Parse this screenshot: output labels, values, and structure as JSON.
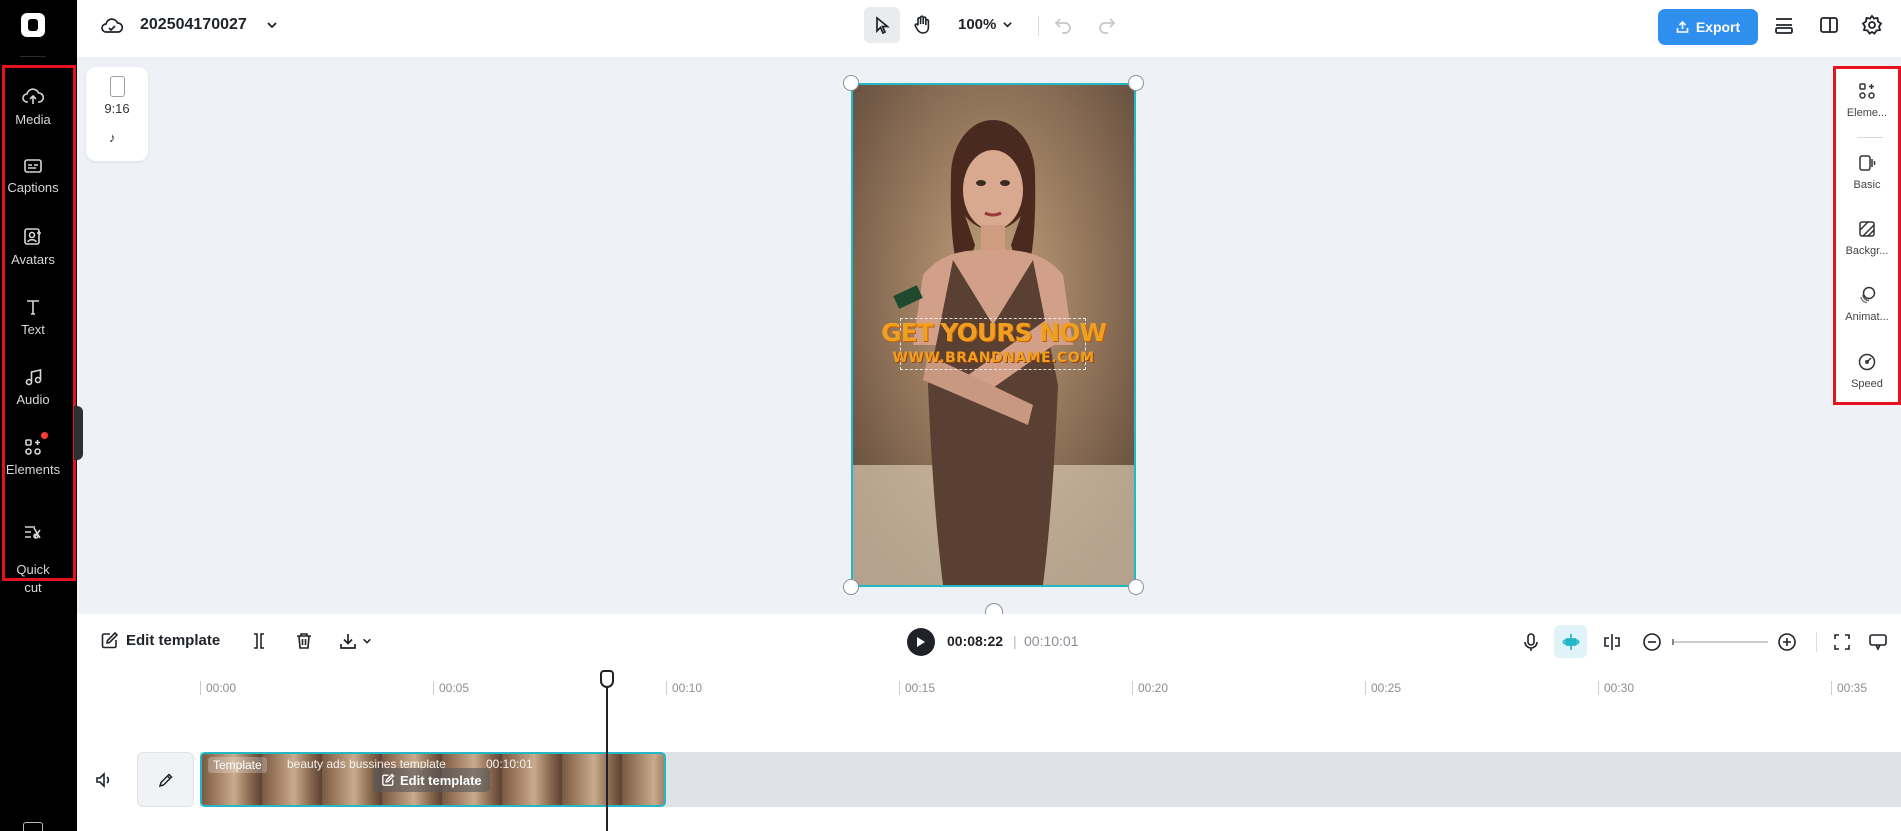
{
  "left_nav": {
    "items": [
      {
        "id": "media",
        "label": "Media",
        "icon": "cloud-upload-icon"
      },
      {
        "id": "captions",
        "label": "Captions",
        "icon": "captions-icon"
      },
      {
        "id": "avatars",
        "label": "Avatars",
        "icon": "avatar-icon"
      },
      {
        "id": "text",
        "label": "Text",
        "icon": "text-icon"
      },
      {
        "id": "audio",
        "label": "Audio",
        "icon": "music-note-icon"
      },
      {
        "id": "elements",
        "label": "Elements",
        "icon": "elements-icon"
      },
      {
        "id": "quickcut",
        "label": "Quick\ncut",
        "icon": "quick-cut-icon"
      }
    ]
  },
  "topbar": {
    "project_name": "202504170027",
    "zoom": "100%",
    "export_label": "Export"
  },
  "aspect": {
    "ratio": "9:16"
  },
  "canvas": {
    "headline": "GET YOURS NOW",
    "url": "WWW.BRANDNAME.COM"
  },
  "right_panel": {
    "items": [
      {
        "id": "elements",
        "label": "Eleme...",
        "icon": "elements-icon"
      },
      {
        "id": "basic",
        "label": "Basic",
        "icon": "basic-icon"
      },
      {
        "id": "background",
        "label": "Backgr...",
        "icon": "background-icon"
      },
      {
        "id": "animation",
        "label": "Animat...",
        "icon": "animation-icon"
      },
      {
        "id": "speed",
        "label": "Speed",
        "icon": "speed-icon"
      }
    ]
  },
  "timeline_toolbar": {
    "edit_template_label": "Edit template",
    "current_time": "00:08:22",
    "separator": "|",
    "total_time": "00:10:01"
  },
  "ruler": {
    "ticks": [
      "00:00",
      "00:05",
      "00:10",
      "00:15",
      "00:20",
      "00:25",
      "00:30",
      "00:35"
    ]
  },
  "clip": {
    "tag": "Template",
    "name": "beauty ads bussines template",
    "duration": "00:10:01",
    "edit_label": "Edit template"
  },
  "colors": {
    "accent": "#2f8fee",
    "selection": "#23b8c6",
    "highlight_box": "#e6121c"
  }
}
